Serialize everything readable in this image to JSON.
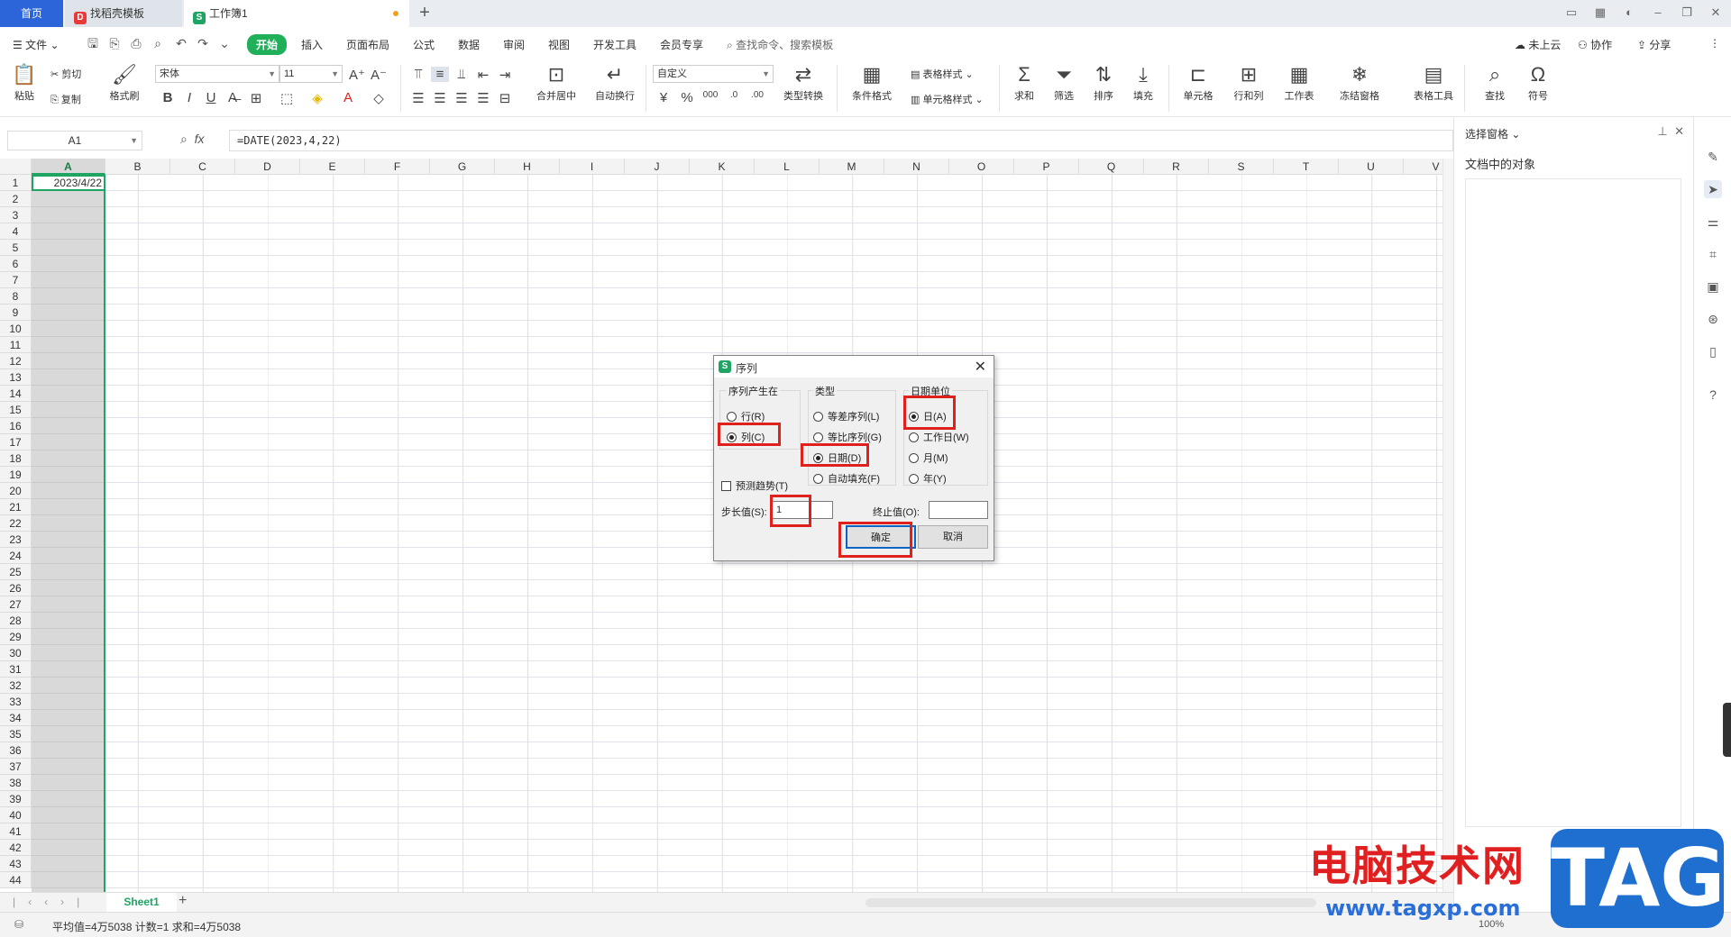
{
  "tabs": {
    "home": "首页",
    "template": "找稻壳模板",
    "workbook": "工作簿1"
  },
  "menu": {
    "file": "文件",
    "items": [
      "开始",
      "插入",
      "页面布局",
      "公式",
      "数据",
      "审阅",
      "视图",
      "开发工具",
      "会员专享"
    ],
    "search_cmd": "查找命令、搜索模板",
    "cloud": "未上云",
    "collab": "协作",
    "share": "分享"
  },
  "ribbon": {
    "paste": "粘贴",
    "cut": "剪切",
    "copy": "复制",
    "format_painter": "格式刷",
    "font_name": "宋体",
    "font_size": "11",
    "number_format": "自定义",
    "merge_center": "合并居中",
    "wrap_text": "自动换行",
    "type_convert": "类型转换",
    "cond_format": "条件格式",
    "table_style": "表格样式",
    "cell_style": "单元格样式",
    "sum": "求和",
    "filter": "筛选",
    "sort": "排序",
    "fill": "填充",
    "cell": "单元格",
    "row_col": "行和列",
    "worksheet": "工作表",
    "freeze": "冻结窗格",
    "table_tools": "表格工具",
    "find": "查找",
    "symbol": "符号"
  },
  "formula_bar": {
    "name_box": "A1",
    "formula": "=DATE(2023,4,22)"
  },
  "grid": {
    "columns": [
      "A",
      "B",
      "C",
      "D",
      "E",
      "F",
      "G",
      "H",
      "I",
      "J",
      "K",
      "L",
      "M",
      "N",
      "O",
      "P",
      "Q",
      "R",
      "S",
      "T",
      "U",
      "V"
    ],
    "row_count": 44,
    "a1_value": "2023/4/22"
  },
  "sheet_tab": "Sheet1",
  "status": {
    "summary": "平均值=4万5038   计数=1   求和=4万5038",
    "zoom": "100%"
  },
  "right_pane": {
    "title": "选择窗格",
    "subtitle": "文档中的对象"
  },
  "dialog": {
    "title": "序列",
    "series_in": {
      "label": "序列产生在",
      "rows": "行(R)",
      "columns": "列(C)"
    },
    "type": {
      "label": "类型",
      "linear": "等差序列(L)",
      "growth": "等比序列(G)",
      "date": "日期(D)",
      "autofill": "自动填充(F)"
    },
    "date_unit": {
      "label": "日期单位",
      "day": "日(A)",
      "weekday": "工作日(W)",
      "month": "月(M)",
      "year": "年(Y)"
    },
    "trend": "预测趋势(T)",
    "step_label": "步长值(S):",
    "step_value": "1",
    "stop_label": "终止值(O):",
    "stop_value": "",
    "ok": "确定",
    "cancel": "取消"
  },
  "watermark": {
    "text": "电脑技术网",
    "url": "www.tagxp.com",
    "badge": "TAG"
  },
  "colors": {
    "accent_green": "#1fa463",
    "tab_blue": "#2b65d9",
    "highlight_red": "#e0201c"
  }
}
